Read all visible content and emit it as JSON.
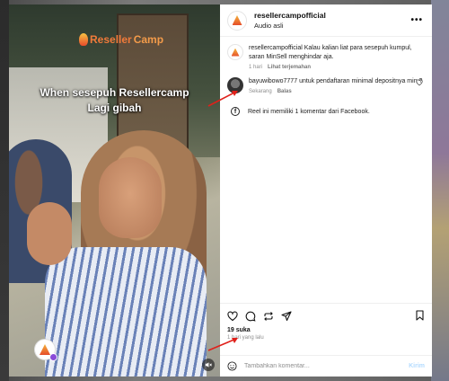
{
  "video": {
    "brand": {
      "part1": "Reseller",
      "part2": "Camp"
    },
    "caption_line1": "When sesepuh Resellercamp",
    "caption_line2": "Lagi gibah"
  },
  "header": {
    "username": "resellercampofficial",
    "audio": "Audio asli",
    "more_icon": "more-horizontal-icon"
  },
  "caption_comment": {
    "username": "resellercampofficial",
    "text": "Kalau kalian liat para sesepuh kumpul, saran MinSell menghindar aja.",
    "time": "1 hari",
    "translate": "Lihat terjemahan"
  },
  "comment": {
    "username": "bayuwibowo7777",
    "text": "untuk pendaftaran minimal depositnya min ?",
    "time": "Sekarang",
    "reply": "Balas"
  },
  "facebook_note": "Reel ini memiliki 1 komentar dari Facebook.",
  "actions": {
    "likes": "19 suka",
    "time": "1 hari yang lalu"
  },
  "composer": {
    "placeholder": "Tambahkan komentar...",
    "send": "Kirim"
  },
  "colors": {
    "annotation_arrow": "#e0201a",
    "brand_orange": "#f07a3a",
    "send_disabled": "#b3dbff"
  }
}
